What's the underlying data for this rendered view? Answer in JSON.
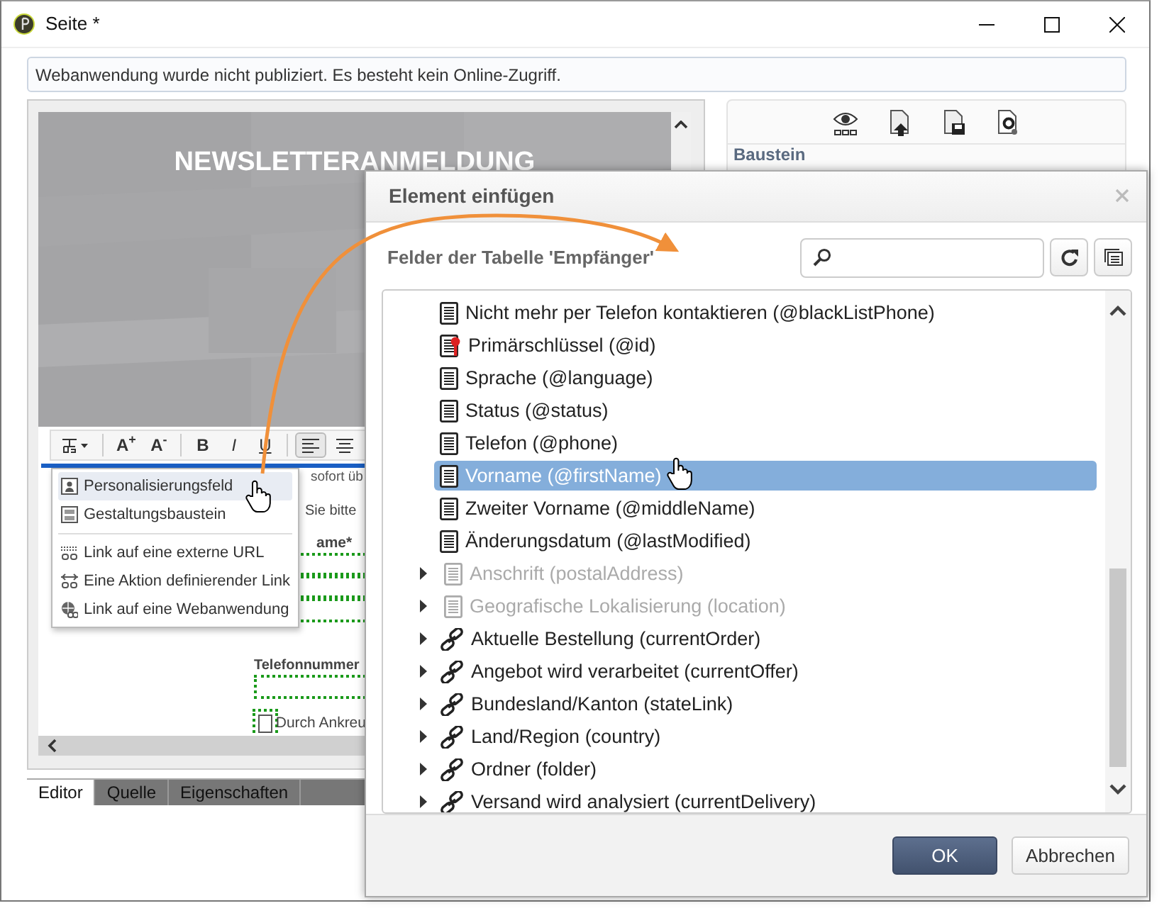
{
  "window": {
    "title": "Seite *"
  },
  "notice": "Webanwendung wurde nicht publiziert. Es besteht kein Online-Zugriff.",
  "editor": {
    "heading": "NEWSLETTERANMELDUNG",
    "toolbar": [
      {
        "kind": "insert"
      },
      {
        "kind": "text",
        "label": "A$^{+}$"
      },
      {
        "kind": "text",
        "label": "A$^{-}$"
      },
      {
        "kind": "bold",
        "label": "B"
      },
      {
        "kind": "italic",
        "label": "I"
      },
      {
        "kind": "underline",
        "label": "U"
      },
      {
        "kind": "align-left",
        "selected": true
      },
      {
        "kind": "align-center",
        "selected": false
      }
    ],
    "insert_menu": [
      {
        "items": [
          {
            "kind": "field",
            "label": "Personalisierungsfeld",
            "selected": true
          },
          {
            "kind": "block",
            "label": "Gestaltungsbaustein",
            "selected": false
          }
        ]
      },
      {
        "items": [
          {
            "kind": "url",
            "label": "Link auf eine externe URL",
            "selected": false
          },
          {
            "kind": "action",
            "label": "Eine Aktion definierender Link",
            "selected": false
          },
          {
            "kind": "webapp",
            "label": "Link auf eine Webanwendung",
            "selected": false
          }
        ]
      }
    ],
    "content": [
      {
        "kind": "current-line",
        "text": "sofort üb"
      },
      {
        "kind": "partial",
        "text": "Sie bitte"
      },
      {
        "kind": "partial-label",
        "text": "ame*"
      },
      {
        "kind": "input"
      },
      {
        "kind": "label",
        "text": "Telefonnummer"
      },
      {
        "kind": "input"
      },
      {
        "kind": "checkbox",
        "text": "Durch Ankreu",
        "checked": false
      }
    ]
  },
  "tabs": [
    {
      "label": "Editor",
      "selected": true
    },
    {
      "label": "Quelle",
      "selected": false
    },
    {
      "label": "Eigenschaften",
      "selected": false
    }
  ],
  "right_panel": {
    "title": "Baustein"
  },
  "dialog": {
    "title": "Element einfügen",
    "subtitle": "Felder der Tabelle 'Empfänger'",
    "tree": [
      {
        "kind": "field",
        "label": "Nicht mehr per Telefon kontaktieren (@blackListPhone)",
        "selected": false,
        "disabled": false
      },
      {
        "kind": "key",
        "label": "Primärschlüssel (@id)",
        "selected": false,
        "disabled": false
      },
      {
        "kind": "field",
        "label": "Sprache (@language)",
        "selected": false,
        "disabled": false
      },
      {
        "kind": "field",
        "label": "Status (@status)",
        "selected": false,
        "disabled": false
      },
      {
        "kind": "field",
        "label": "Telefon (@phone)",
        "selected": false,
        "disabled": false
      },
      {
        "kind": "field",
        "label": "Vorname (@firstName)",
        "selected": true,
        "disabled": false
      },
      {
        "kind": "field",
        "label": "Zweiter Vorname (@middleName)",
        "selected": false,
        "disabled": false
      },
      {
        "kind": "field",
        "label": "Änderungsdatum (@lastModified)",
        "selected": false,
        "disabled": false
      },
      {
        "kind": "field",
        "label": "Anschrift (postalAddress)",
        "selected": false,
        "disabled": true,
        "expanded": false
      },
      {
        "kind": "field",
        "label": "Geografische Lokalisierung (location)",
        "selected": false,
        "disabled": true,
        "expanded": false
      },
      {
        "kind": "link",
        "label": "Aktuelle Bestellung (currentOrder)",
        "selected": false,
        "disabled": false,
        "expanded": false
      },
      {
        "kind": "link",
        "label": "Angebot wird verarbeitet (currentOffer)",
        "selected": false,
        "disabled": false,
        "expanded": false
      },
      {
        "kind": "link",
        "label": "Bundesland/Kanton (stateLink)",
        "selected": false,
        "disabled": false,
        "expanded": false
      },
      {
        "kind": "link",
        "label": "Land/Region (country)",
        "selected": false,
        "disabled": false,
        "expanded": false
      },
      {
        "kind": "link",
        "label": "Ordner (folder)",
        "selected": false,
        "disabled": false,
        "expanded": false
      },
      {
        "kind": "link",
        "label": "Versand wird analysiert (currentDelivery)",
        "selected": false,
        "disabled": false,
        "expanded": false
      }
    ],
    "buttons": [
      {
        "kind": "primary",
        "label": "OK"
      },
      {
        "kind": "secondary",
        "label": "Abbrechen"
      }
    ]
  }
}
